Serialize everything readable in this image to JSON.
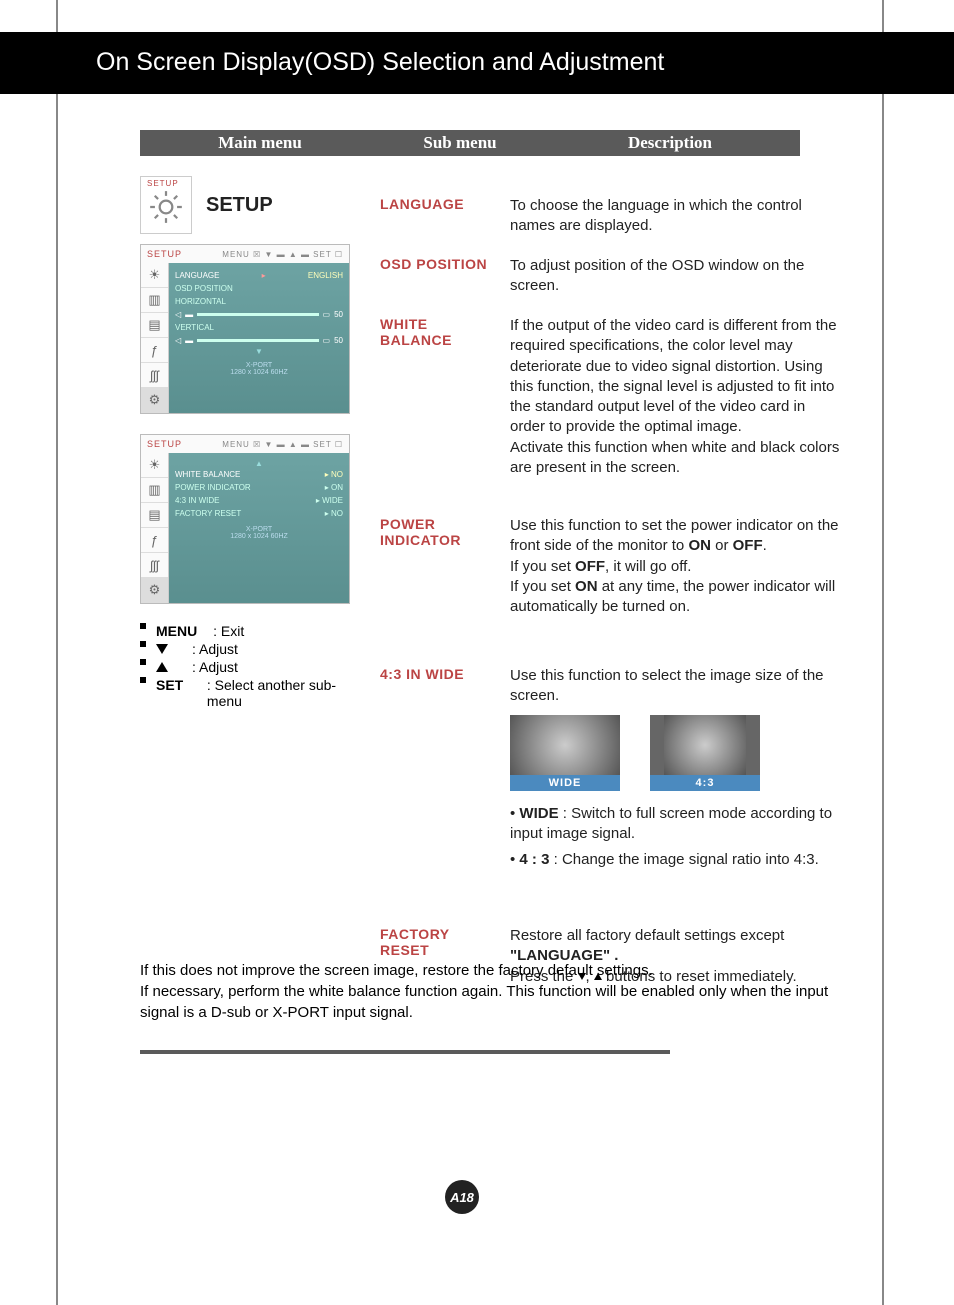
{
  "header": {
    "title": "On Screen Display(OSD) Selection and Adjustment"
  },
  "columns": {
    "main": "Main menu",
    "sub": "Sub menu",
    "desc": "Description"
  },
  "main": {
    "title": "SETUP",
    "iconTinyLabel": "SETUP"
  },
  "osd1": {
    "topLabel": "SETUP",
    "topIcons": "MENU ☒  ▼ ▬  ▲ ▬  SET ☐",
    "language": {
      "label": "LANGUAGE",
      "value": "ENGLISH"
    },
    "osdpos": "OSD  POSITION",
    "horizontal": {
      "label": "HORIZONTAL",
      "value": "50"
    },
    "vertical": {
      "label": "VERTICAL",
      "value": "50"
    },
    "info": "X-PORT\n1280 x 1024  60HZ"
  },
  "osd2": {
    "topLabel": "SETUP",
    "topIcons": "MENU ☒  ▼ ▬  ▲ ▬  SET ☐",
    "rows": [
      {
        "label": "WHITE  BALANCE",
        "value": "▸ NO"
      },
      {
        "label": "POWER  INDICATOR",
        "value": "▸ ON"
      },
      {
        "label": "4:3 IN WIDE",
        "value": "▸ WIDE"
      },
      {
        "label": "FACTORY  RESET",
        "value": "▸ NO"
      }
    ],
    "info": "X-PORT\n1280 x 1024  60HZ"
  },
  "legend": {
    "menu": {
      "key": "MENU",
      "desc": ": Exit"
    },
    "down": {
      "desc": ": Adjust"
    },
    "up": {
      "desc": ": Adjust"
    },
    "set": {
      "key": "SET",
      "desc": ": Select another sub-menu"
    }
  },
  "items": {
    "language": {
      "sub": "LANGUAGE",
      "desc": "To choose the language in which the control names are displayed."
    },
    "osdposition": {
      "sub": "OSD POSITION",
      "desc": "To adjust position of the OSD window on the screen."
    },
    "whitebalance": {
      "sub": "WHITE BALANCE",
      "desc": "If the output of the video card is different from the required specifications, the color level may deteriorate due to video signal distortion. Using this function, the signal level is adjusted to fit into the standard output level of the video card in order to provide the optimal image.\nActivate this function when white and black colors are present in the screen."
    },
    "powerindicator": {
      "sub": "POWER INDICATOR",
      "descPart1": "Use this function to set the power indicator on the front side of the monitor to ",
      "on": "ON",
      "or": " or ",
      "off": "OFF",
      "descPart2": ".",
      "line2a": "If you set ",
      "line2off": "OFF",
      "line2b": ", it will go off.",
      "line3a": "If you set ",
      "line3on": "ON",
      "line3b": " at any time, the power indicator will automatically be turned on."
    },
    "aspect": {
      "sub": "4:3 IN WIDE",
      "desc": "Use this function to select the image size of the screen.",
      "wideCap": "WIDE",
      "n43Cap": "4:3",
      "b1label": "WIDE",
      "b1text": " : Switch to full screen mode according to input image signal.",
      "b2label": "4 : 3",
      "b2text": " : Change the image signal ratio into 4:3."
    },
    "factory": {
      "sub": "FACTORY RESET",
      "desc1": "Restore all factory default settings except ",
      "lang": "\"LANGUAGE\" .",
      "desc2a": "Press the  ",
      "desc2b": " buttons to reset immediately."
    }
  },
  "footnote": "If this does not improve the screen image, restore the factory default settings.\nIf necessary, perform the white balance function again. This function will be enabled only when the input signal is a D-sub or X-PORT input signal.",
  "pageNumber": "A18"
}
